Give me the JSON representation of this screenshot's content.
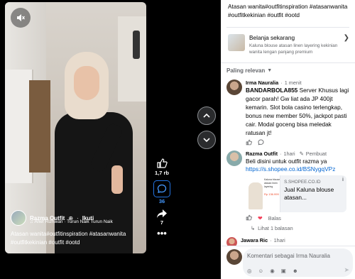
{
  "video": {
    "author_name": "Razma Outfit",
    "follow_label": "Ikuti",
    "music": "Arief Rizhwan · Turun Naik Turun Naik",
    "caption_line1": "Atasan wanita#outfitinspiration #atasanwanita",
    "caption_line2": "#outfitkekinian #outfit  #ootd",
    "likes": "1,7 rb",
    "comments": "36",
    "shares": "7"
  },
  "post": {
    "caption": "Atasan wanita#outfitinspiration #atasanwanita #outfitkekinian #outfit  #ootd"
  },
  "shop": {
    "title": "Belanja sekarang",
    "subtitle": "Kaluna blouse atasan linen layering kekinian wanita lengan panjang premium"
  },
  "sort_label": "Paling relevan",
  "comments": [
    {
      "name": "Irma Nauralia",
      "time": "1 menit",
      "bold": "BANDARBOLA855",
      "text": " Server Khusus lagi gacor parah! Gw liat ada JP 400jt kemarin. Slot bola casino terlengkap, bonus new member 50%, jackpot pasti cair. Modal goceng bisa meledak ratusan jt!"
    },
    {
      "name": "Razma Outfit",
      "time": "1hari",
      "author_tag": "Pembuat",
      "text": "Beli disini untuk outfit razma ya",
      "link": "https://s.shopee.co.id/BSNygqVPz",
      "card_domain": "S.SHOPEE.CO.ID",
      "card_title": "Jual Kaluna blouse atasan...",
      "card_thumb_title": "Kaluna blouse atasan linen layering",
      "card_thumb_price": "Rp 136.999",
      "reply_label": "Balas",
      "replies_label": "Lihat 1 balasan"
    },
    {
      "name": "Jawara Ric",
      "time": "1hari"
    }
  ],
  "composer": {
    "placeholder": "Komentari sebagai Irma Nauralia"
  }
}
